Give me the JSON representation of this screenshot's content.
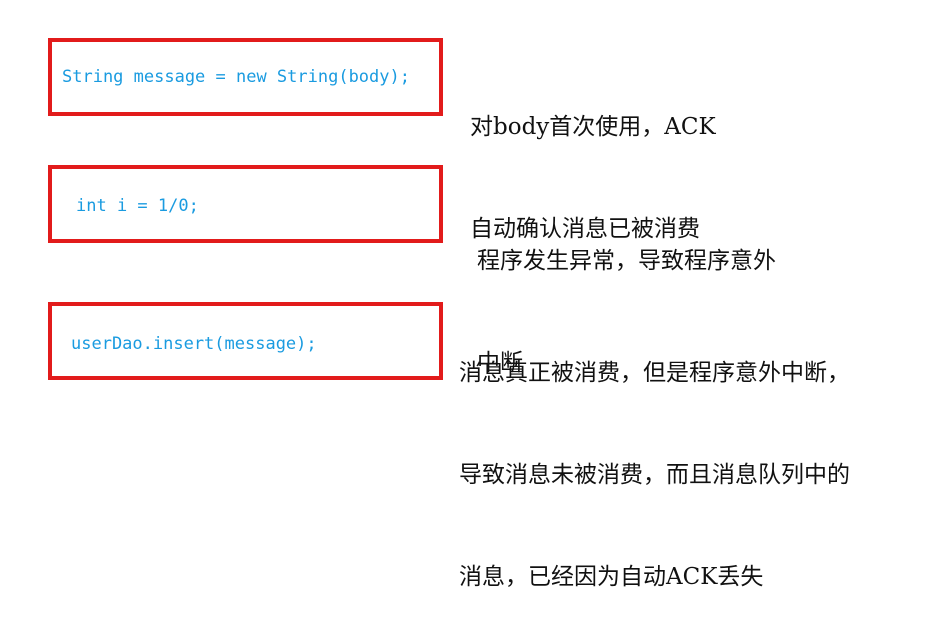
{
  "colors": {
    "box_border": "#e21b1b",
    "code_text": "#1a9be0",
    "note_text": "#111111"
  },
  "steps": [
    {
      "code": "String message = new String(body);",
      "note_lines": [
        "对body首次使用，ACK",
        "自动确认消息已被消费"
      ]
    },
    {
      "code": "int i = 1/0;",
      "note_lines": [
        "程序发生异常，导致程序意外",
        "中断"
      ]
    },
    {
      "code": "userDao.insert(message);",
      "note_lines": [
        "消息真正被消费，但是程序意外中断，",
        "导致消息未被消费，而且消息队列中的",
        "消息，已经因为自动ACK丢失"
      ]
    }
  ]
}
